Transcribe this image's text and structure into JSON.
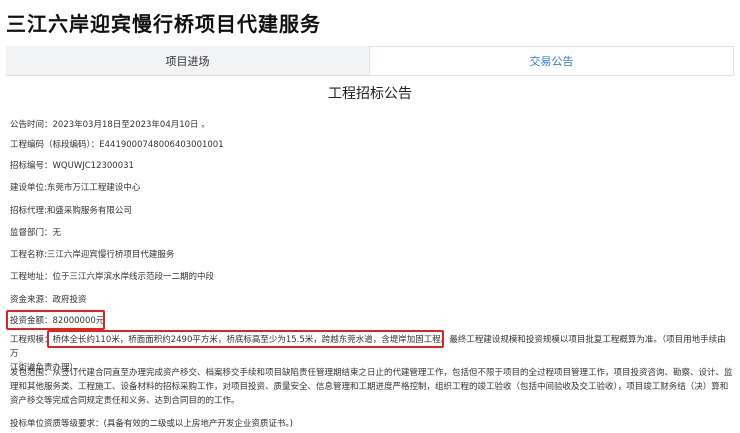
{
  "header": {
    "title": "三江六岸迎宾慢行桥项目代建服务"
  },
  "tabs": [
    {
      "label": "项目进场",
      "active": false
    },
    {
      "label": "交易公告",
      "active": true
    }
  ],
  "notice": {
    "title": "工程招标公告",
    "fields": {
      "publish_time_label": "公告时间：",
      "publish_time": "2023年03月18日至2023年04月10日 。",
      "project_code_label": "工程编码（标段编码）：",
      "project_code": "E4419000748006403001001",
      "tender_no_label": "招标编号：",
      "tender_no": "WQUWJC12300031",
      "builder_label": "建设单位:",
      "builder": "东莞市万江工程建设中心",
      "agent_label": "招标代理:",
      "agent": "和盛采购服务有限公司",
      "supervisor_label": "监督部门：",
      "supervisor": "无",
      "project_name_label": "工程名称:",
      "project_name": "三江六岸迎宾慢行桥项目代建服务",
      "address_label": "工程地址：",
      "address": "位于三江六岸滨水岸线示范段一二期的中段",
      "funding_label": "资金来源：",
      "funding": "政府投资",
      "investment_label": "投资金额：",
      "investment": "82000000元",
      "scale_label": "工程规模：",
      "scale_highlight": "桥体全长约110米，桥面面积约2490平方米，桥底标高至少为15.5米，跨越东莞水道，含堤岸加固工程。",
      "scale_rest": "最终工程建设规模和投资规模以项目批复工程概算为准。（项目用地手续由万",
      "scale_line2": "江街道负责办理）。",
      "scope_label": "发包范围：",
      "scope": "从签订代建合同直至办理完成资产移交、档案移交手续和项目缺陷责任管理期结束之日止的代建管理工作，包括但不限于项目的全过程项目管理工作，项目投资咨询、勘察、设计、监理和其他服务类、工程施工、设备材料的招标采购工作，对项目投资、质量安全、信息管理和工期进度严格控制，组织工程的竣工验收（包括中间验收及交工验收），项目竣工财务结（决）算和资产移交等完成合同规定责任和义务、达到合同目的的工作。",
      "qualification_label": "投标单位资质等级要求：",
      "qualification": "(具备有效的二级或以上房地产开发企业资质证书。)"
    }
  },
  "colors": {
    "accent": "#2f7bd8",
    "highlight_border": "#e02424",
    "tab_inactive_bg": "#f2f3f5"
  }
}
